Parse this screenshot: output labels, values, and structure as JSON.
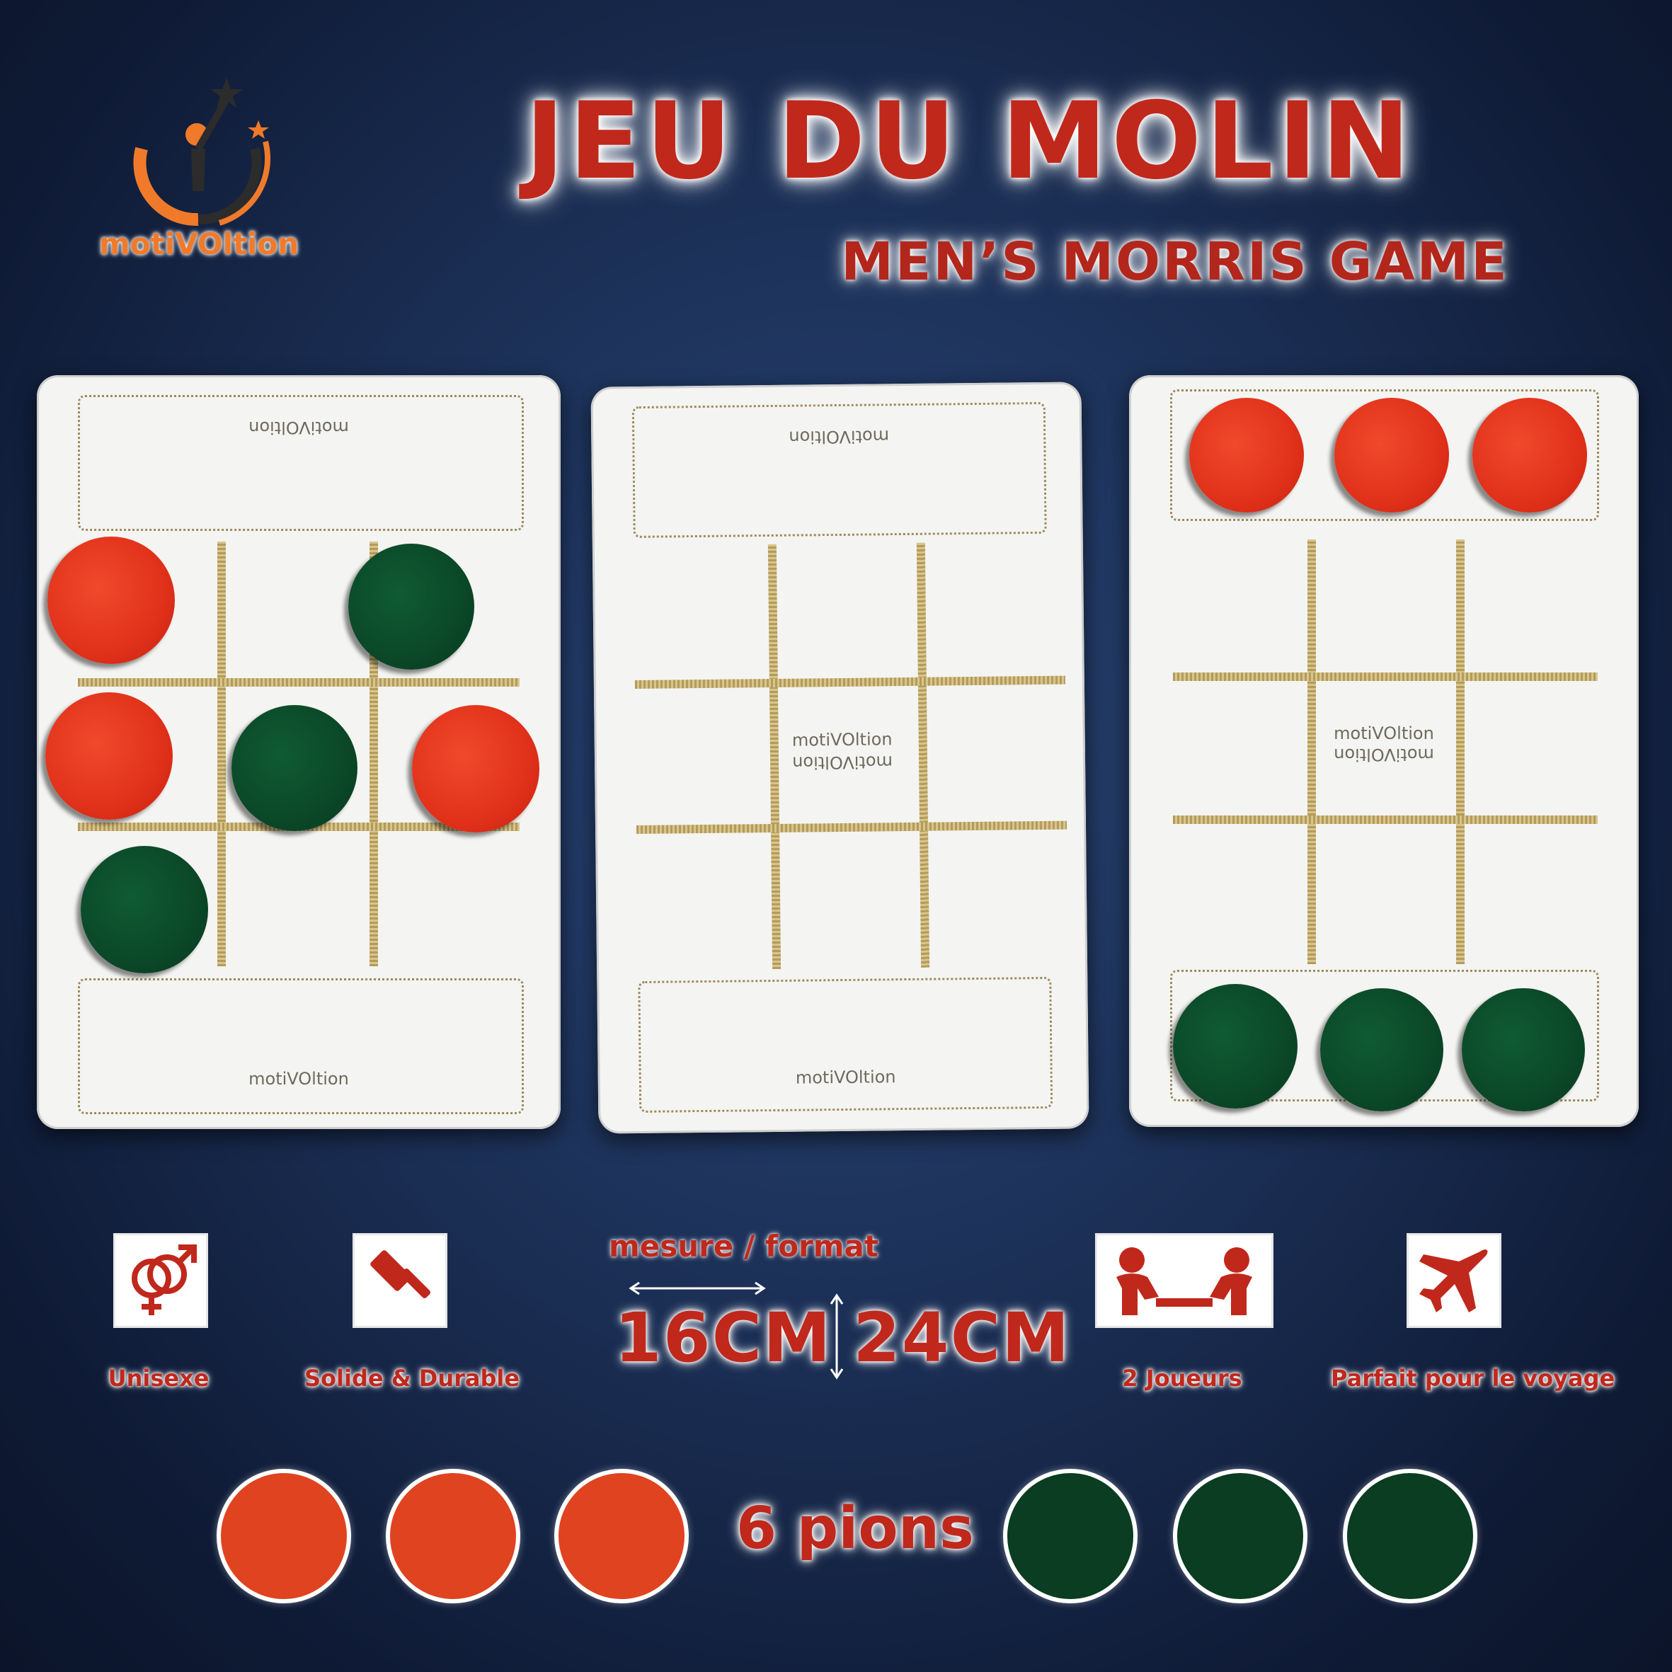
{
  "title": "JEU DU MOLIN",
  "subtitle": "MEN’S MORRIS GAME",
  "brand": {
    "logo_text": "motiVOltion",
    "board_text": "motiVOltion"
  },
  "features": [
    {
      "icon": "gender-icon",
      "label": "Unisexe"
    },
    {
      "icon": "gavel-icon",
      "label": "Solide & Durable"
    },
    {
      "icon": "two-players-icon",
      "label": "2 Joueurs"
    },
    {
      "icon": "airplane-icon",
      "label": "Parfait pour le voyage"
    }
  ],
  "dimensions": {
    "caption": "mesure / format",
    "width": "16CM",
    "height": "24CM"
  },
  "pawns": {
    "label": "6 pions",
    "red_count": 3,
    "green_count": 3
  },
  "colors": {
    "accent": "#c0281c",
    "red_pawn": "#e0431f",
    "green_pawn": "#0a3d22",
    "board": "#f4f4f2",
    "grid_line": "#b49b5a"
  }
}
